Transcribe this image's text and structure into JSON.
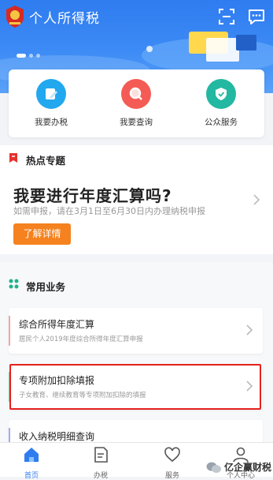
{
  "header": {
    "title": "个人所得税"
  },
  "quick_actions": [
    {
      "label": "我要办税",
      "color": "#22a8ee"
    },
    {
      "label": "我要查询",
      "color": "#f45b54"
    },
    {
      "label": "公众服务",
      "color": "#23b8a2"
    }
  ],
  "hot": {
    "section_title": "热点专题",
    "headline": "我要进行年度汇算吗?",
    "sub": "如需申报，请在3月1日至6月30日内办理纳税申报",
    "button": "了解详情"
  },
  "business": {
    "section_title": "常用业务",
    "items": [
      {
        "title": "综合所得年度汇算",
        "subtitle": "居民个人2019年度综合所得年度汇算申报",
        "accent": "#f2a7a5"
      },
      {
        "title": "专项附加扣除填报",
        "subtitle": "子女教育、继续教育等专项附加扣除的填报",
        "accent": "#8dd7a3"
      },
      {
        "title": "收入纳税明细查询",
        "subtitle": "",
        "accent": "#a3a9f5"
      }
    ]
  },
  "tabbar": {
    "items": [
      {
        "label": "首页",
        "active": true
      },
      {
        "label": "办税",
        "active": false
      },
      {
        "label": "服务",
        "active": false
      },
      {
        "label": "个人中心",
        "active": false
      }
    ]
  },
  "watermark": {
    "text": "亿企赢财税"
  },
  "colors": {
    "brand_blue": "#2f7cf0",
    "orange": "#f5821f",
    "highlight_red": "#e5211d"
  }
}
